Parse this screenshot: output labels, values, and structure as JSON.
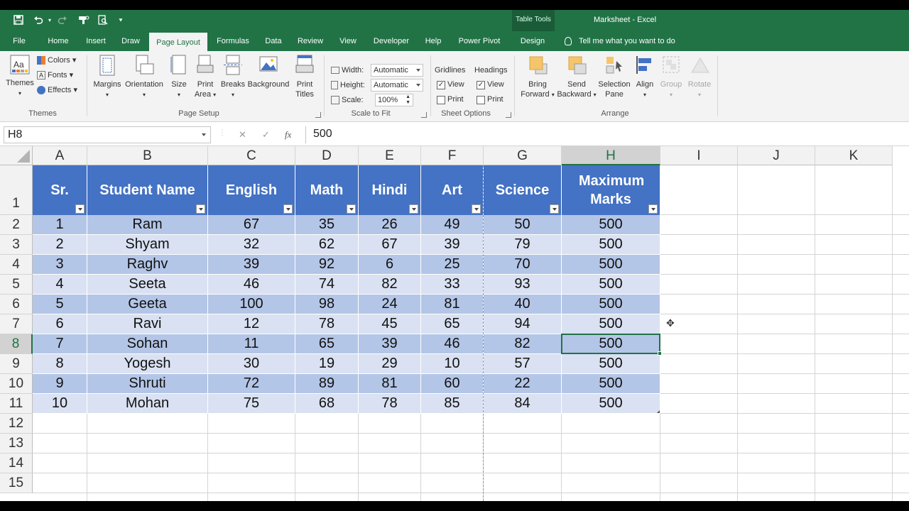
{
  "titlebar": {
    "table_tools": "Table Tools",
    "document_title": "Marksheet  -  Excel"
  },
  "tabs": [
    {
      "label": "File"
    },
    {
      "label": "Home"
    },
    {
      "label": "Insert"
    },
    {
      "label": "Draw"
    },
    {
      "label": "Page Layout",
      "active": true
    },
    {
      "label": "Formulas"
    },
    {
      "label": "Data"
    },
    {
      "label": "Review"
    },
    {
      "label": "View"
    },
    {
      "label": "Developer"
    },
    {
      "label": "Help"
    },
    {
      "label": "Power Pivot"
    },
    {
      "label": "Design"
    }
  ],
  "tell_me": "Tell me what you want to do",
  "ribbon": {
    "themes": {
      "themes_label": "Themes",
      "colors_label": "Colors",
      "fonts_label": "Fonts",
      "effects_label": "Effects",
      "group_label": "Themes"
    },
    "page_setup": {
      "margins": "Margins",
      "orientation": "Orientation",
      "size": "Size",
      "print_area_1": "Print",
      "print_area_2": "Area",
      "breaks": "Breaks",
      "background": "Background",
      "print_titles_1": "Print",
      "print_titles_2": "Titles",
      "group_label": "Page Setup"
    },
    "scale_to_fit": {
      "width_label": "Width:",
      "width_value": "Automatic",
      "height_label": "Height:",
      "height_value": "Automatic",
      "scale_label": "Scale:",
      "scale_value": "100%",
      "group_label": "Scale to Fit"
    },
    "sheet_options": {
      "gridlines": "Gridlines",
      "headings": "Headings",
      "view": "View",
      "print": "Print",
      "gridlines_view_checked": true,
      "gridlines_print_checked": false,
      "headings_view_checked": true,
      "headings_print_checked": false,
      "group_label": "Sheet Options"
    },
    "arrange": {
      "bring_forward_1": "Bring",
      "bring_forward_2": "Forward",
      "send_backward_1": "Send",
      "send_backward_2": "Backward",
      "selection_pane_1": "Selection",
      "selection_pane_2": "Pane",
      "align": "Align",
      "group": "Group",
      "rotate": "Rotate",
      "group_label": "Arrange"
    }
  },
  "formula_bar": {
    "name_box": "H8",
    "formula": "500",
    "fx": "fx"
  },
  "columns": [
    "A",
    "B",
    "C",
    "D",
    "E",
    "F",
    "G",
    "H",
    "I",
    "J",
    "K"
  ],
  "selected_column": "H",
  "selected_row": 8,
  "rows": [
    "1",
    "2",
    "3",
    "4",
    "5",
    "6",
    "7",
    "8",
    "9",
    "10",
    "11",
    "12",
    "13",
    "14",
    "15"
  ],
  "table": {
    "headers": [
      "Sr.",
      "Student Name",
      "English",
      "Math",
      "Hindi",
      "Art",
      "Science",
      "Maximum Marks"
    ],
    "data": [
      [
        "1",
        "Ram",
        "67",
        "35",
        "26",
        "49",
        "50",
        "500"
      ],
      [
        "2",
        "Shyam",
        "32",
        "62",
        "67",
        "39",
        "79",
        "500"
      ],
      [
        "3",
        "Raghv",
        "39",
        "92",
        "6",
        "25",
        "70",
        "500"
      ],
      [
        "4",
        "Seeta",
        "46",
        "74",
        "82",
        "33",
        "93",
        "500"
      ],
      [
        "5",
        "Geeta",
        "100",
        "98",
        "24",
        "81",
        "40",
        "500"
      ],
      [
        "6",
        "Ravi",
        "12",
        "78",
        "45",
        "65",
        "94",
        "500"
      ],
      [
        "7",
        "Sohan",
        "11",
        "65",
        "39",
        "46",
        "82",
        "500"
      ],
      [
        "8",
        "Yogesh",
        "30",
        "19",
        "29",
        "10",
        "57",
        "500"
      ],
      [
        "9",
        "Shruti",
        "72",
        "89",
        "81",
        "60",
        "22",
        "500"
      ],
      [
        "10",
        "Mohan",
        "75",
        "68",
        "78",
        "85",
        "84",
        "500"
      ]
    ]
  },
  "colors": {
    "excel_green": "#217346",
    "table_header": "#4472c4",
    "band_dark": "#b4c6e7",
    "band_light": "#d9e1f2"
  }
}
